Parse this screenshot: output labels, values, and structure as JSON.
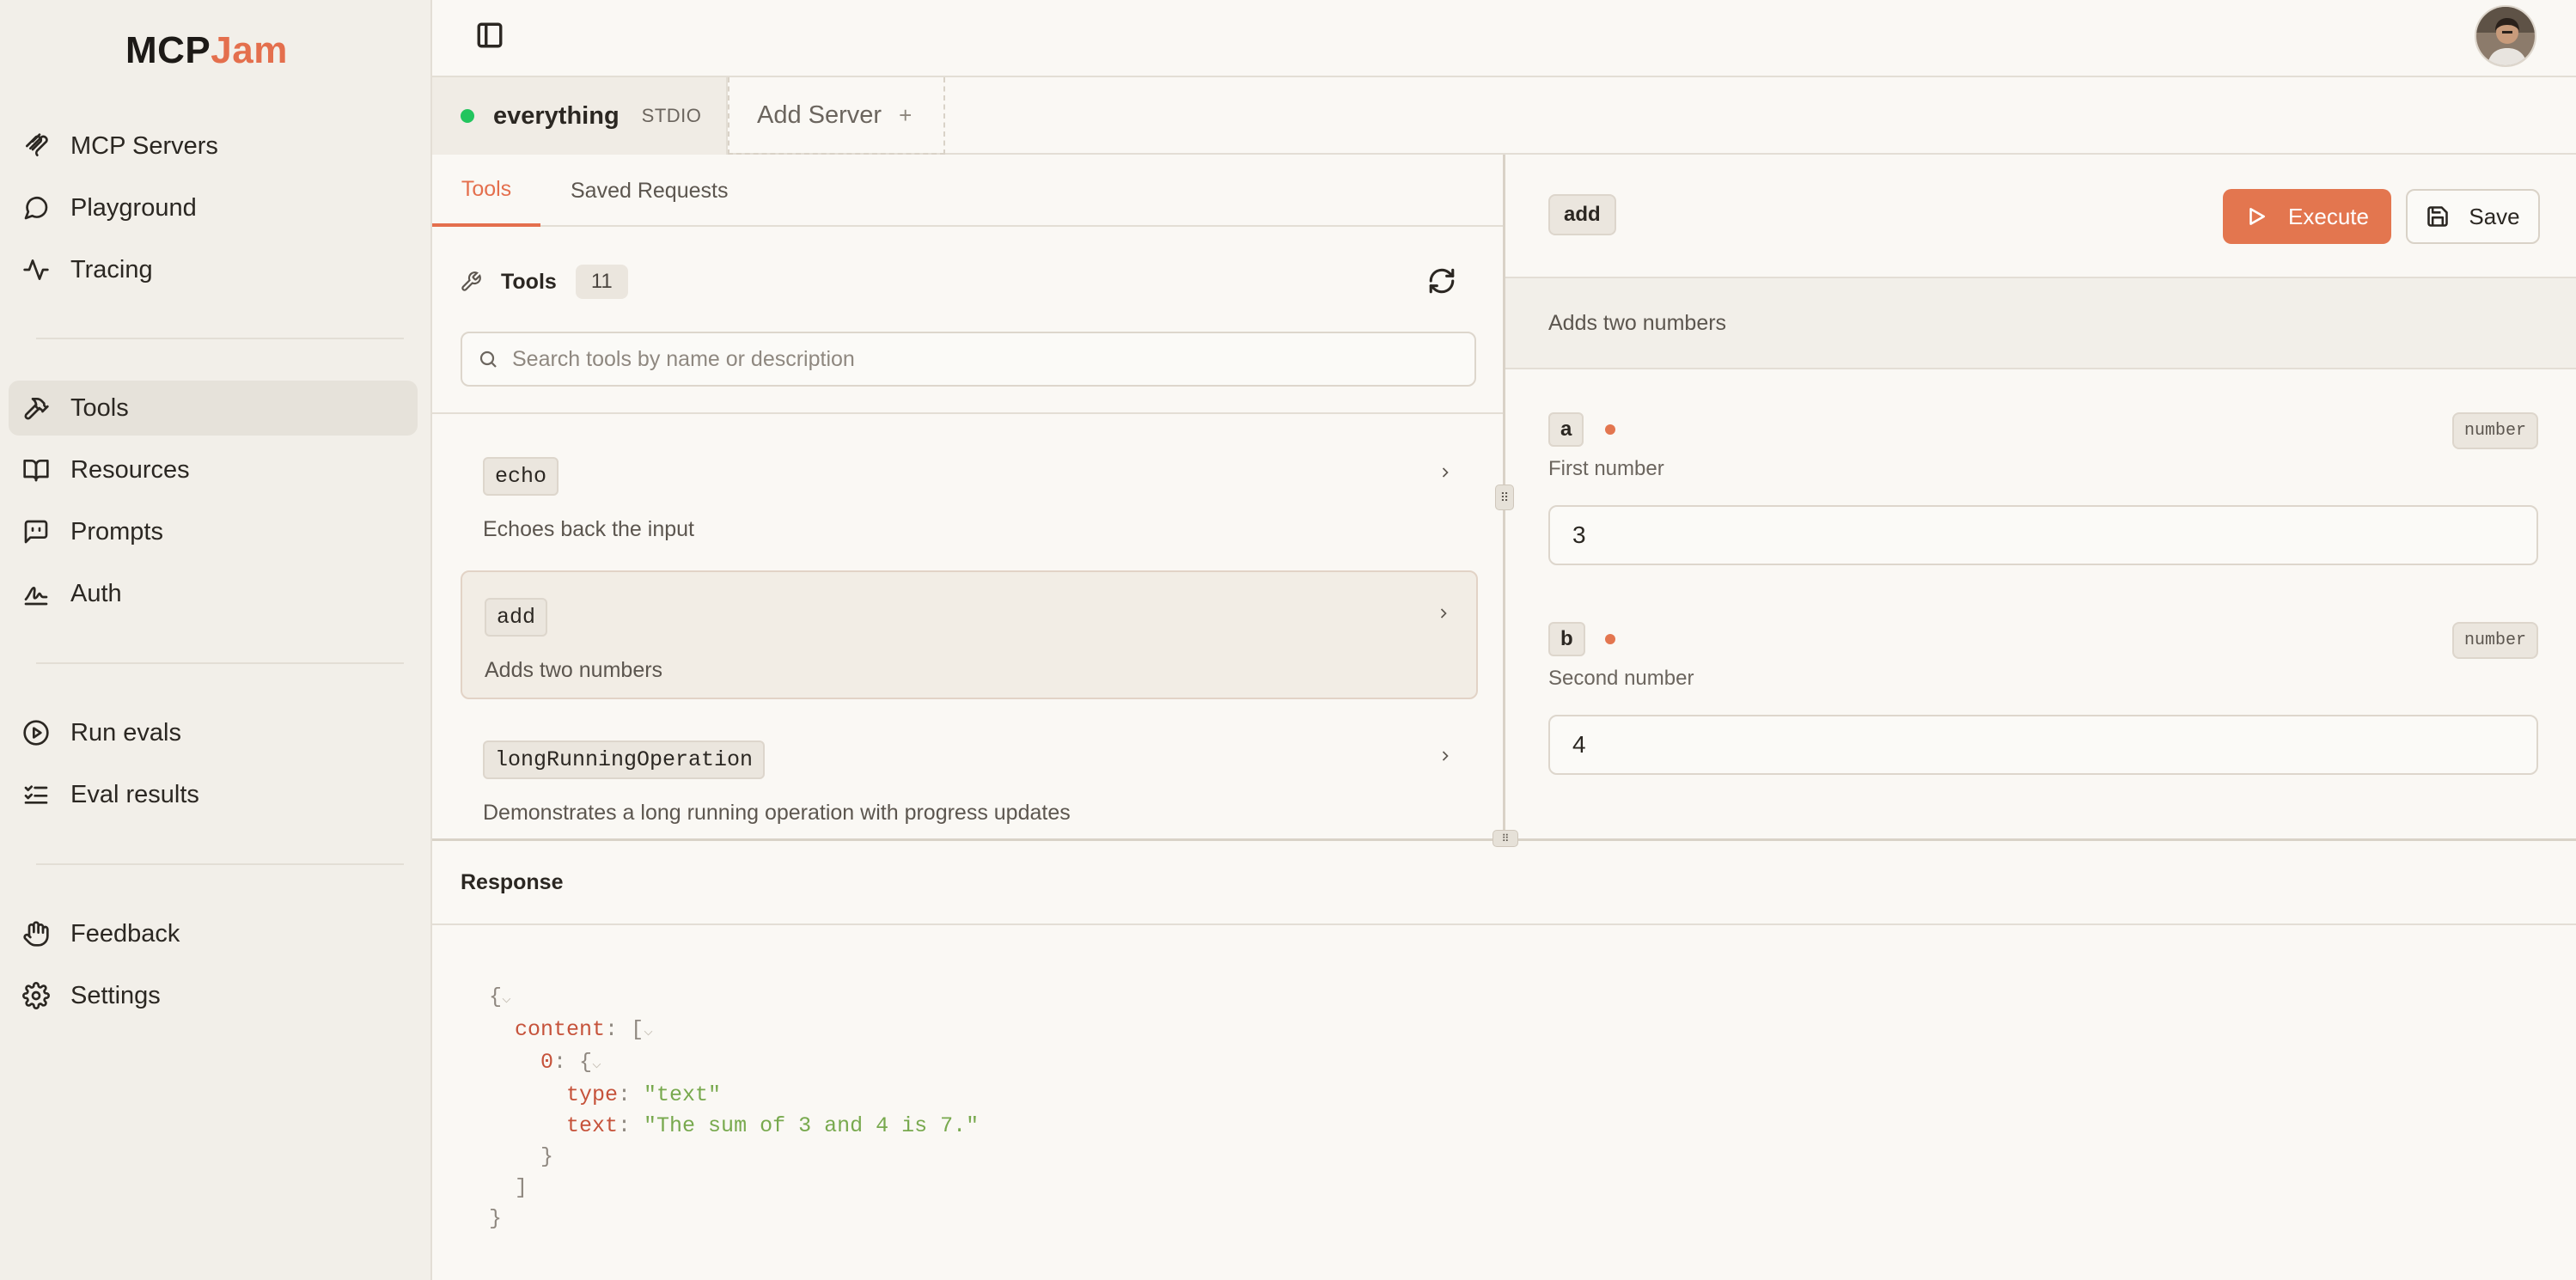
{
  "app": {
    "logo_part1": "MCP",
    "logo_part2": "Jam"
  },
  "sidebar": {
    "group1": [
      {
        "label": "MCP Servers",
        "icon": "mcp-servers-icon"
      },
      {
        "label": "Playground",
        "icon": "chat-bubble-icon"
      },
      {
        "label": "Tracing",
        "icon": "activity-icon"
      }
    ],
    "group2": [
      {
        "label": "Tools",
        "icon": "hammer-icon",
        "active": true
      },
      {
        "label": "Resources",
        "icon": "book-icon"
      },
      {
        "label": "Prompts",
        "icon": "message-square-icon"
      },
      {
        "label": "Auth",
        "icon": "signature-icon"
      }
    ],
    "group3": [
      {
        "label": "Run evals",
        "icon": "play-circle-icon"
      },
      {
        "label": "Eval results",
        "icon": "list-checks-icon"
      }
    ],
    "group4": [
      {
        "label": "Feedback",
        "icon": "hand-icon"
      },
      {
        "label": "Settings",
        "icon": "gear-icon"
      }
    ]
  },
  "servers": {
    "active": {
      "name": "everything",
      "type": "STDIO",
      "status_color": "#22c55e"
    },
    "add_label": "Add Server",
    "add_icon": "+"
  },
  "tools_panel": {
    "tabs": [
      "Tools",
      "Saved Requests"
    ],
    "active_tab": "Tools",
    "header": "Tools",
    "count": "11",
    "search_placeholder": "Search tools by name or description",
    "items": [
      {
        "name": "echo",
        "description": "Echoes back the input"
      },
      {
        "name": "add",
        "description": "Adds two numbers",
        "selected": true
      },
      {
        "name": "longRunningOperation",
        "description": "Demonstrates a long running operation with progress updates"
      }
    ]
  },
  "detail": {
    "tool_name": "add",
    "execute_label": "Execute",
    "save_label": "Save",
    "description": "Adds two numbers",
    "params": [
      {
        "name": "a",
        "type": "number",
        "description": "First number",
        "value": "3"
      },
      {
        "name": "b",
        "type": "number",
        "description": "Second number",
        "value": "4"
      }
    ]
  },
  "response": {
    "title": "Response",
    "json": {
      "open_brace": "{",
      "content_key": "content",
      "open_bracket": "[",
      "index_key": "0",
      "type_key": "type",
      "type_value": "\"text\"",
      "text_key": "text",
      "text_value": "\"The sum of 3 and 4 is 7.\"",
      "close_inner": "}",
      "close_bracket": "]",
      "close_brace": "}"
    }
  },
  "colors": {
    "accent": "#e3764f",
    "brand": "#e46f4d",
    "status_ok": "#22c55e"
  }
}
